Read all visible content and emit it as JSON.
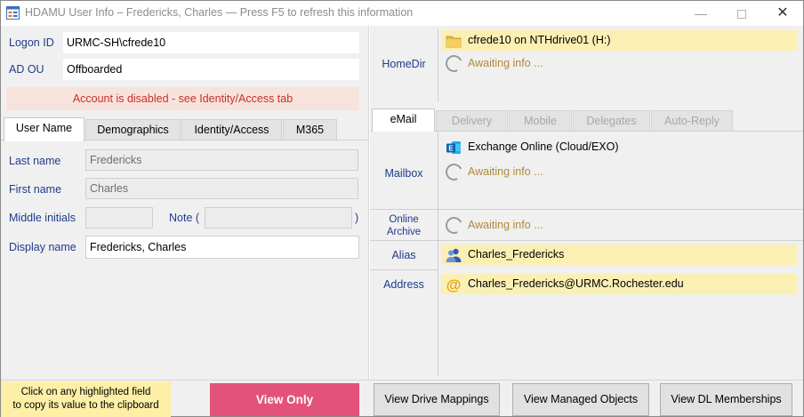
{
  "window": {
    "title": "HDAMU User Info – Fredericks, Charles   —   Press F5 to refresh this information",
    "controls": {
      "minimize": "—",
      "close": "✕"
    }
  },
  "account": {
    "logon_label": "Logon ID",
    "logon_value": "URMC-SH\\cfrede10",
    "ou_label": "AD OU",
    "ou_value": "Offboarded",
    "warning": "Account is disabled - see Identity/Access tab"
  },
  "left_tabs": [
    "User Name",
    "Demographics",
    "Identity/Access",
    "M365"
  ],
  "user_name": {
    "last_name_label": "Last name",
    "last_name_value": "Fredericks",
    "first_name_label": "First name",
    "first_name_value": "Charles",
    "middle_label": "Middle initials",
    "middle_value": "",
    "note_label": "Note (",
    "note_close": ")",
    "note_value": "",
    "display_label": "Display name",
    "display_value": "Fredericks, Charles"
  },
  "homedir": {
    "label": "HomeDir",
    "drive": "cfrede10 on NTHdrive01 (H:)",
    "awaiting": "Awaiting info ..."
  },
  "email_tabs": [
    "eMail",
    "Delivery",
    "Mobile",
    "Delegates",
    "Auto-Reply"
  ],
  "email": {
    "mailbox_label": "Mailbox",
    "mailbox_value": "Exchange Online (Cloud/EXO)",
    "mailbox_awaiting": "Awaiting info ...",
    "archive_label_1": "Online",
    "archive_label_2": "Archive",
    "archive_awaiting": "Awaiting info ...",
    "alias_label": "Alias",
    "alias_value": "Charles_Fredericks",
    "address_label": "Address",
    "address_value": "Charles_Fredericks@URMC.Rochester.edu"
  },
  "bottom": {
    "hint_line1": "Click on any highlighted field",
    "hint_line2": "to copy its value to the clipboard",
    "view_only": "View Only",
    "drive_mappings": "View Drive Mappings",
    "managed_objects": "View Managed Objects",
    "dl_memberships": "View DL Memberships"
  },
  "icons": {
    "app": "app-window-icon",
    "folder": "folder-icon",
    "spinner": "loading-spinner-icon",
    "exchange": "exchange-icon",
    "people": "people-icon",
    "at": "at-sign-icon"
  },
  "colors": {
    "label_blue": "#1f3b8c",
    "highlight_yellow": "#fcefb4",
    "warning_bg": "#f8e2dc",
    "warning_text": "#c8312b",
    "view_only_pink": "#e2527a",
    "awaiting_text": "#b08a3a"
  }
}
